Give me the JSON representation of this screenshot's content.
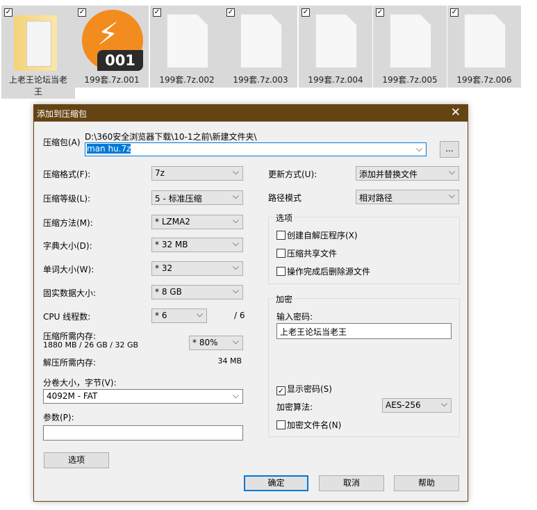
{
  "files": [
    {
      "name": "上老王论坛当老王",
      "icon": "folder-icon"
    },
    {
      "name": "199套.7z.001",
      "icon": "archive-icon",
      "badge": "001"
    },
    {
      "name": "199套.7z.002",
      "icon": "file-icon"
    },
    {
      "name": "199套.7z.003",
      "icon": "file-icon"
    },
    {
      "name": "199套.7z.004",
      "icon": "file-icon"
    },
    {
      "name": "199套.7z.005",
      "icon": "file-icon"
    },
    {
      "name": "199套.7z.006",
      "icon": "file-icon"
    }
  ],
  "dialog": {
    "title": "添加到压缩包",
    "archive_label": "压缩包(A)",
    "archive_path": "D:\\360安全浏览器下载\\10-1之前\\新建文件夹\\",
    "archive_name": "man hu.7z",
    "browse": "...",
    "format_label": "压缩格式(F):",
    "format": "7z",
    "level_label": "压缩等级(L):",
    "level": "5 - 标准压缩",
    "method_label": "压缩方法(M):",
    "method": "* LZMA2",
    "dict_label": "字典大小(D):",
    "dict": "* 32 MB",
    "word_label": "单词大小(W):",
    "word": "* 32",
    "solid_label": "固实数据大小:",
    "solid": "* 8 GB",
    "cpu_label": "CPU 线程数:",
    "cpu": "* 6",
    "cpu_max": "/ 6",
    "mem_label": "压缩所需内存:",
    "mem_value": "1880 MB / 26 GB / 32 GB",
    "mem_pct": "* 80%",
    "dmem_label": "解压所需内存:",
    "dmem_value": "34 MB",
    "split_label": "分卷大小，字节(V):",
    "split": "4092M - FAT",
    "params_label": "参数(P):",
    "params": "",
    "options_button": "选项",
    "update_label": "更新方式(U):",
    "update": "添加并替换文件",
    "path_label": "路径模式",
    "path": "相对路径",
    "options_group": "选项",
    "opt_sfx": "创建自解压程序(X)",
    "opt_shared": "压缩共享文件",
    "opt_delete": "操作完成后删除源文件",
    "enc_group": "加密",
    "pwd_label": "输入密码:",
    "pwd": "上老王论坛当老王",
    "show_pwd": "显示密码(S)",
    "enc_method_label": "加密算法:",
    "enc_method": "AES-256",
    "enc_names": "加密文件名(N)",
    "ok": "确定",
    "cancel": "取消",
    "help": "帮助"
  }
}
